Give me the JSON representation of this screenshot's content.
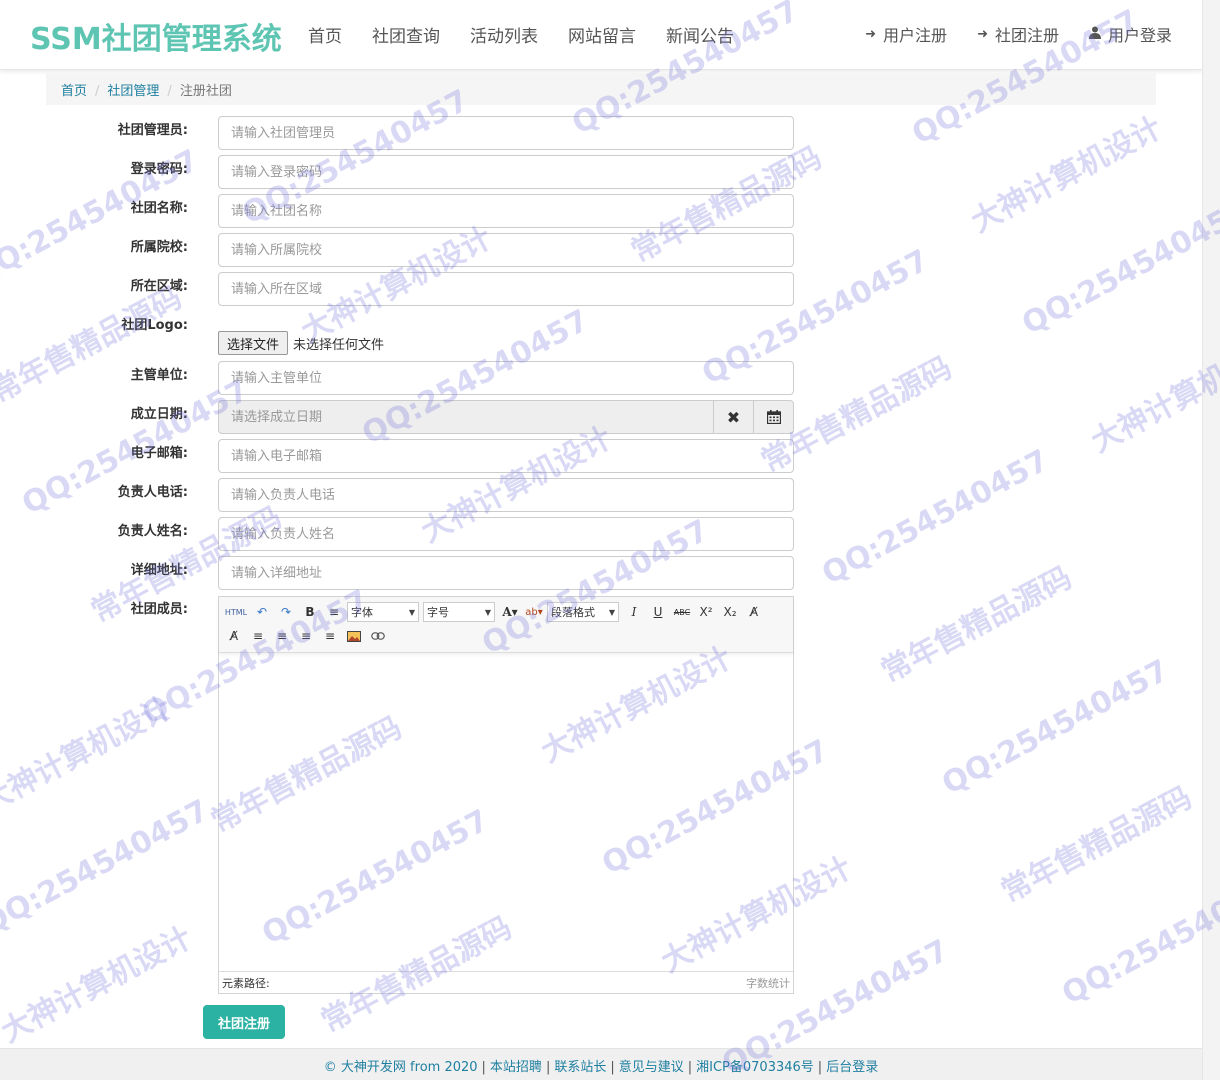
{
  "brand": "SSM社团管理系统",
  "nav": {
    "left": [
      "首页",
      "社团查询",
      "活动列表",
      "网站留言",
      "新闻公告"
    ],
    "right": [
      {
        "label": "用户注册",
        "icon": "sign-in-icon"
      },
      {
        "label": "社团注册",
        "icon": "sign-in-icon"
      },
      {
        "label": "用户登录",
        "icon": "user-icon"
      }
    ]
  },
  "breadcrumb": {
    "home": "首页",
    "section": "社团管理",
    "current": "注册社团"
  },
  "form": {
    "manager": {
      "label": "社团管理员:",
      "placeholder": "请输入社团管理员"
    },
    "password": {
      "label": "登录密码:",
      "placeholder": "请输入登录密码"
    },
    "name": {
      "label": "社团名称:",
      "placeholder": "请输入社团名称"
    },
    "college": {
      "label": "所属院校:",
      "placeholder": "请输入所属院校"
    },
    "region": {
      "label": "所在区域:",
      "placeholder": "请输入所在区域"
    },
    "logo": {
      "label": "社团Logo:",
      "button": "选择文件",
      "status": "未选择任何文件"
    },
    "unit": {
      "label": "主管单位:",
      "placeholder": "请输入主管单位"
    },
    "date": {
      "label": "成立日期:",
      "placeholder": "请选择成立日期"
    },
    "email": {
      "label": "电子邮箱:",
      "placeholder": "请输入电子邮箱"
    },
    "phone": {
      "label": "负责人电话:",
      "placeholder": "请输入负责人电话"
    },
    "leader": {
      "label": "负责人姓名:",
      "placeholder": "请输入负责人姓名"
    },
    "address": {
      "label": "详细地址:",
      "placeholder": "请输入详细地址"
    },
    "members": {
      "label": "社团成员:"
    }
  },
  "editor": {
    "font_select": "字体",
    "size_select": "字号",
    "para_select": "段落格式",
    "html_label": "HTML",
    "status_path": "元素路径:",
    "status_count": "字数统计"
  },
  "submit_label": "社团注册",
  "footer": {
    "copyright": "© 大神开发网 from 2020",
    "links": [
      "本站招聘",
      "联系站长",
      "意见与建议",
      "湘ICP备0703346号",
      "后台登录"
    ]
  },
  "watermarks": [
    "QQ:254540457",
    "大神计算机设计",
    "常年售精品源码"
  ],
  "colors": {
    "brand": "#5fc5b3",
    "primary": "#2cb2a3",
    "link": "#1e7fa0"
  }
}
